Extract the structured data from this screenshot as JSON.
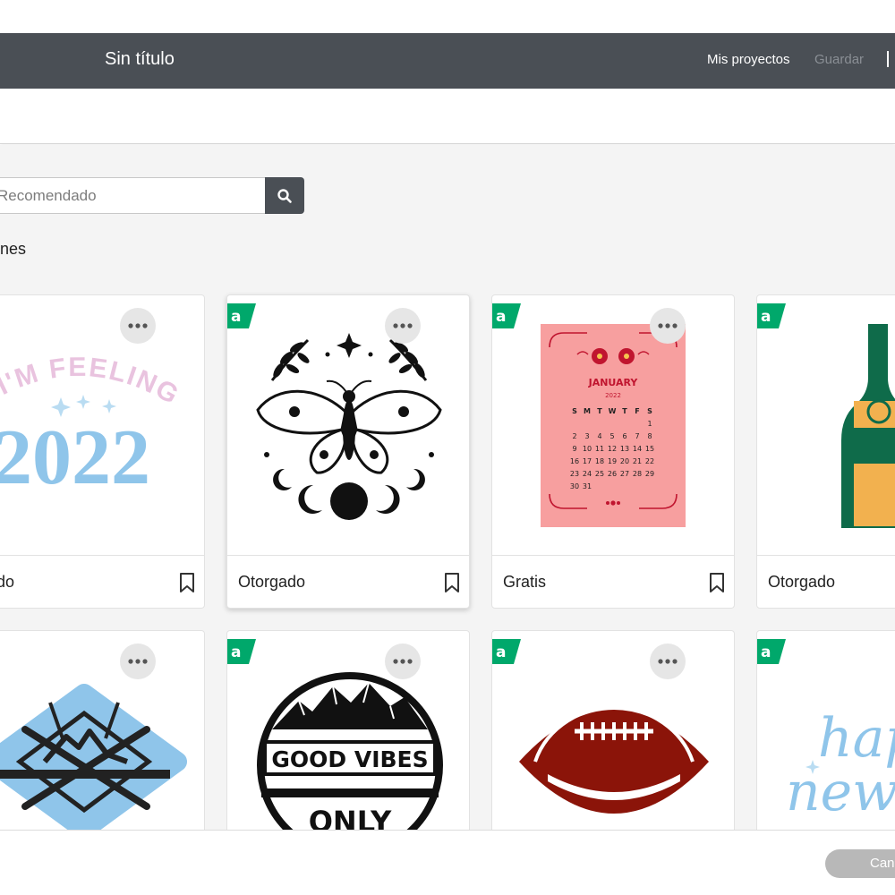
{
  "header": {
    "title": "Sin título",
    "projects_label": "Mis proyectos",
    "save_label": "Guardar"
  },
  "search": {
    "placeholder": "Recomendado"
  },
  "section": {
    "label": "nes"
  },
  "cards": [
    {
      "label": "rgado",
      "image_text": [
        "I'M FEELING",
        "2022"
      ]
    },
    {
      "label": "Otorgado"
    },
    {
      "label": "Gratis",
      "image_text": [
        "JANUARY",
        "2022",
        "S",
        "M",
        "T",
        "W",
        "T",
        "F",
        "S",
        "1",
        "2",
        "3",
        "4",
        "5",
        "6",
        "7",
        "8",
        "9",
        "10",
        "11",
        "12",
        "13",
        "14",
        "15",
        "16",
        "17",
        "18",
        "19",
        "20",
        "21",
        "22",
        "23",
        "24",
        "25",
        "26",
        "27",
        "28",
        "29",
        "30",
        "31"
      ]
    },
    {
      "label": "Otorgado"
    },
    {},
    {
      "image_text": [
        "GOOD VIBES",
        "ONLY"
      ]
    },
    {},
    {
      "image_text": [
        "happ",
        "new y"
      ]
    }
  ],
  "footer": {
    "cancel_label": "Can"
  },
  "colors": {
    "header_bg": "#4a4f55",
    "badge_green": "#00a86b",
    "calendar_pink": "#f79f9f",
    "calendar_red": "#c0152f",
    "bottle_green": "#0f6b4a",
    "bottle_gold": "#f2b14f",
    "football_red": "#8b1409",
    "pale_blue": "#8fc5ea"
  },
  "icons": [
    "search-icon",
    "more-icon",
    "bookmark-icon",
    "badge-a-icon"
  ]
}
